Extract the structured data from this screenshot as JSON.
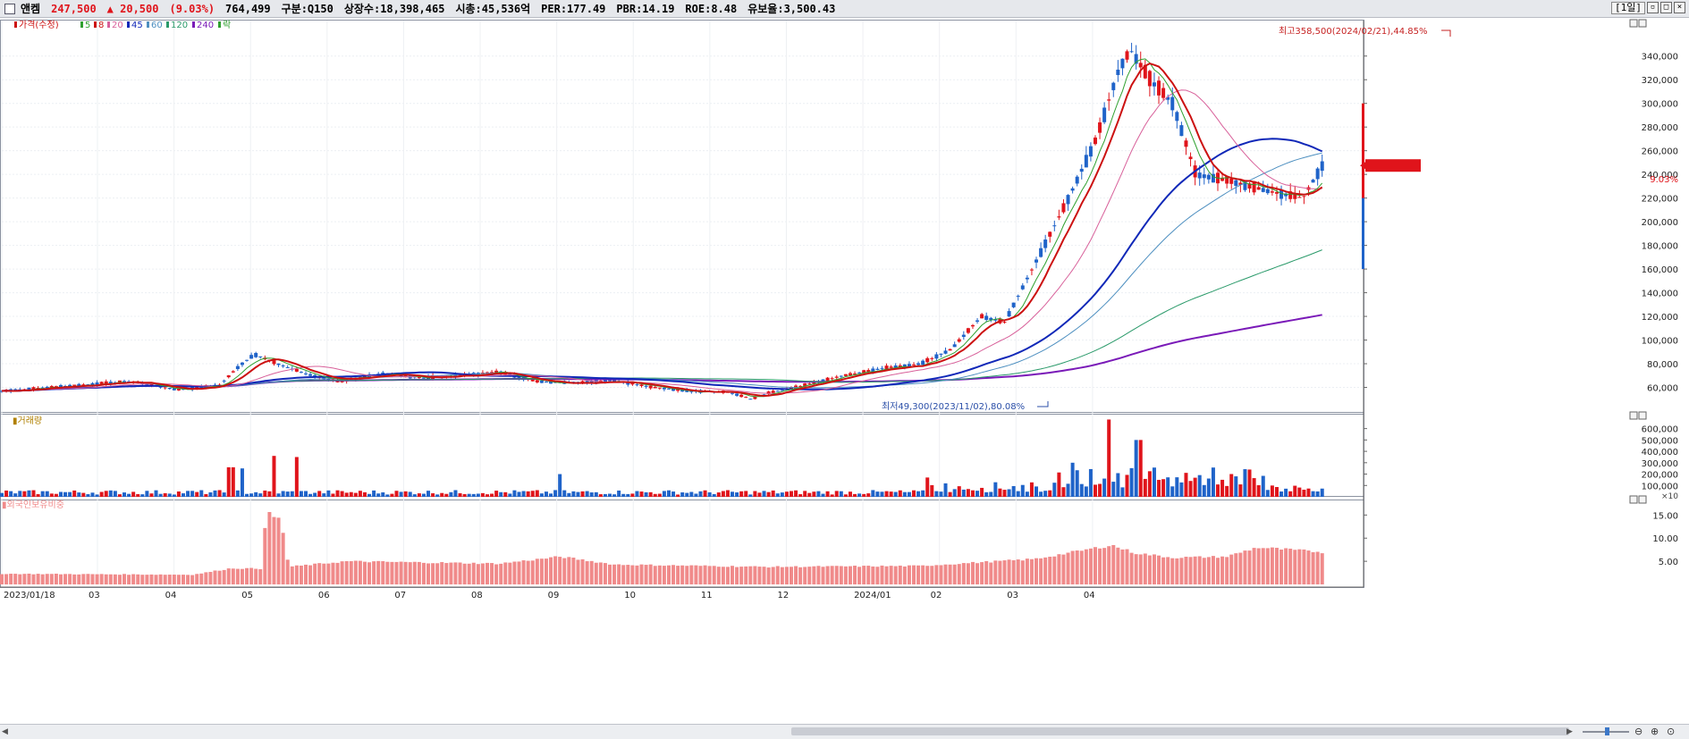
{
  "header": {
    "name": "앤켐",
    "price": "247,500",
    "change": "▲ 20,500",
    "change_pct": "(9.03%)",
    "volume": "764,499",
    "market": "구분:Q150",
    "shares": "상장수:18,398,465",
    "market_cap": "시총:45,536억",
    "per": "PER:177.49",
    "pbr": "PBR:14.19",
    "roe": "ROE:8.48",
    "float_ratio": "유보율:3,500.43",
    "period": "[1일]"
  },
  "colors": {
    "up": "#e0141b",
    "down": "#1f63c9",
    "ma5": "#2fa02f",
    "ma8": "#cc1111",
    "ma20": "#d8609a",
    "ma45": "#1028b8",
    "ma60": "#4d8fc0",
    "ma120": "#2a9a6a",
    "ma240": "#7a1ab8",
    "foreign": "#f08a8a"
  },
  "chart_data": {
    "type": "candlestick",
    "title": "앤켐",
    "price_legend": [
      {
        "label": "가격(수정)",
        "color": "#cc1111"
      },
      {
        "label": "5",
        "color": "#2fa02f"
      },
      {
        "label": "8",
        "color": "#cc1111"
      },
      {
        "label": "20",
        "color": "#d8609a"
      },
      {
        "label": "45",
        "color": "#1028b8"
      },
      {
        "label": "60",
        "color": "#4d8fc0"
      },
      {
        "label": "120",
        "color": "#2a9a6a"
      },
      {
        "label": "240",
        "color": "#7a1ab8"
      },
      {
        "label": "락",
        "color": "#2fa02f"
      }
    ],
    "x_labels": [
      "2023/01/18",
      "03",
      "04",
      "05",
      "06",
      "07",
      "08",
      "09",
      "10",
      "11",
      "12",
      "2024/01",
      "02",
      "03",
      "04"
    ],
    "y_price_ticks": [
      "60,000",
      "80,000",
      "100,000",
      "120,000",
      "140,000",
      "160,000",
      "180,000",
      "200,000",
      "220,000",
      "240,000",
      "260,000",
      "280,000",
      "300,000",
      "320,000",
      "340,000"
    ],
    "y_price_range": [
      40000,
      370000
    ],
    "price_keypoints": [
      {
        "m": 0,
        "v": 57000
      },
      {
        "m": 1,
        "v": 62000
      },
      {
        "m": 1.7,
        "v": 65000
      },
      {
        "m": 2.3,
        "v": 58000
      },
      {
        "m": 2.85,
        "v": 62000
      },
      {
        "m": 3.1,
        "v": 78000
      },
      {
        "m": 3.3,
        "v": 88000
      },
      {
        "m": 3.6,
        "v": 80000
      },
      {
        "m": 4.0,
        "v": 71000
      },
      {
        "m": 4.4,
        "v": 65000
      },
      {
        "m": 5.0,
        "v": 72000
      },
      {
        "m": 5.5,
        "v": 68000
      },
      {
        "m": 6.0,
        "v": 70000
      },
      {
        "m": 6.5,
        "v": 73000
      },
      {
        "m": 7.0,
        "v": 65000
      },
      {
        "m": 7.5,
        "v": 64000
      },
      {
        "m": 8.0,
        "v": 66000
      },
      {
        "m": 8.5,
        "v": 60000
      },
      {
        "m": 9.0,
        "v": 57000
      },
      {
        "m": 9.5,
        "v": 56000
      },
      {
        "m": 9.8,
        "v": 50000
      },
      {
        "m": 10.0,
        "v": 55000
      },
      {
        "m": 10.5,
        "v": 62000
      },
      {
        "m": 11.0,
        "v": 70000
      },
      {
        "m": 11.5,
        "v": 76000
      },
      {
        "m": 12.0,
        "v": 80000
      },
      {
        "m": 12.4,
        "v": 92000
      },
      {
        "m": 12.8,
        "v": 120000
      },
      {
        "m": 13.1,
        "v": 115000
      },
      {
        "m": 13.5,
        "v": 165000
      },
      {
        "m": 13.9,
        "v": 215000
      },
      {
        "m": 14.3,
        "v": 270000
      },
      {
        "m": 14.6,
        "v": 330000
      },
      {
        "m": 14.75,
        "v": 345000
      },
      {
        "m": 15.0,
        "v": 320000
      },
      {
        "m": 15.3,
        "v": 300000
      },
      {
        "m": 15.6,
        "v": 240000
      },
      {
        "m": 16.0,
        "v": 235000
      },
      {
        "m": 16.3,
        "v": 230000
      },
      {
        "m": 16.6,
        "v": 225000
      },
      {
        "m": 17.0,
        "v": 220000
      },
      {
        "m": 17.25,
        "v": 247500
      }
    ],
    "annotations": [
      {
        "text": "최고358,500(2024/02/21),44.85%",
        "price": 358500
      },
      {
        "text": "최저49,300(2023/11/02),80.08%",
        "price": 49300
      }
    ],
    "last_price_label": "247,500",
    "last_pct_label": "9.03%",
    "volume_panel": {
      "label": "거래량",
      "y_ticks": [
        "100,000",
        "200,000",
        "300,000",
        "400,000",
        "500,000",
        "600,000"
      ],
      "y_range": [
        0,
        660000
      ],
      "multiplier": "×10",
      "spikes": [
        {
          "m": 3.0,
          "v": 260000
        },
        {
          "m": 3.15,
          "v": 250000
        },
        {
          "m": 3.55,
          "v": 360000
        },
        {
          "m": 3.85,
          "v": 350000
        },
        {
          "m": 7.3,
          "v": 200000
        },
        {
          "m": 12.1,
          "v": 170000
        },
        {
          "m": 14.0,
          "v": 300000
        },
        {
          "m": 14.45,
          "v": 680000
        },
        {
          "m": 14.85,
          "v": 500000
        },
        {
          "m": 16.3,
          "v": 240000
        }
      ]
    },
    "foreign_panel": {
      "label": "외국인보유비중",
      "y_ticks": [
        "5.00",
        "10.00",
        "15.00"
      ],
      "y_range": [
        0,
        17
      ],
      "keypoints": [
        {
          "m": 0,
          "v": 2.3
        },
        {
          "m": 2.5,
          "v": 2.1
        },
        {
          "m": 3.0,
          "v": 3.5
        },
        {
          "m": 3.4,
          "v": 3.4
        },
        {
          "m": 3.45,
          "v": 15.5
        },
        {
          "m": 3.65,
          "v": 13.8
        },
        {
          "m": 3.75,
          "v": 3.8
        },
        {
          "m": 4.5,
          "v": 5.0
        },
        {
          "m": 6.5,
          "v": 4.5
        },
        {
          "m": 7.3,
          "v": 6.0
        },
        {
          "m": 8.0,
          "v": 4.3
        },
        {
          "m": 10.0,
          "v": 3.8
        },
        {
          "m": 12.0,
          "v": 4.0
        },
        {
          "m": 13.5,
          "v": 5.5
        },
        {
          "m": 14.5,
          "v": 8.5
        },
        {
          "m": 14.8,
          "v": 6.8
        },
        {
          "m": 15.3,
          "v": 5.8
        },
        {
          "m": 16.0,
          "v": 6.0
        },
        {
          "m": 16.4,
          "v": 8.0
        },
        {
          "m": 17.25,
          "v": 7.0
        }
      ]
    }
  }
}
